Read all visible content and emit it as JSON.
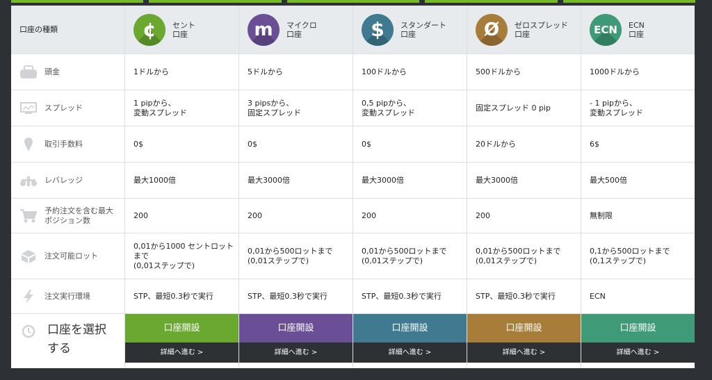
{
  "colors": {
    "cent": "#6aa830",
    "micro": "#6b4f96",
    "standard": "#3f7a91",
    "zero": "#a87d3a",
    "ecn": "#3e9a77",
    "background": "#2d3136"
  },
  "header": {
    "label": "口座の種類",
    "accounts": [
      {
        "glyph": "¢",
        "name_line1": "セント",
        "name_line2": "口座",
        "icon": "cent-icon"
      },
      {
        "glyph": "m",
        "name_line1": "マイクロ",
        "name_line2": "口座",
        "icon": "micro-icon"
      },
      {
        "glyph": "$",
        "name_line1": "スタンダート",
        "name_line2": "口座",
        "icon": "dollar-icon"
      },
      {
        "glyph": "Ø",
        "name_line1": "ゼロスプレッド",
        "name_line2": "口座",
        "icon": "zero-icon"
      },
      {
        "glyph": "ECN",
        "name_line1": "ECN",
        "name_line2": "口座",
        "icon": "ecn-icon"
      }
    ]
  },
  "rows": [
    {
      "label": "頭金",
      "icon": "wallet-icon",
      "values": [
        [
          "1ドルから"
        ],
        [
          "5ドルから"
        ],
        [
          "100ドルから"
        ],
        [
          "500ドルから"
        ],
        [
          "1000ドルから"
        ]
      ]
    },
    {
      "label": "スプレッド",
      "icon": "monitor-icon",
      "values": [
        [
          "1 pipから、",
          "変動スプレッド"
        ],
        [
          "3 pipsから、",
          "固定スプレッド"
        ],
        [
          "0,5 pipから、",
          "変動スプレッド"
        ],
        [
          "固定スプレッド 0 pip"
        ],
        [
          "- 1 pipから、",
          "変動スプレッド"
        ]
      ]
    },
    {
      "label": "取引手数料",
      "icon": "ice-cream-icon",
      "values": [
        [
          "0$"
        ],
        [
          "0$"
        ],
        [
          "0$"
        ],
        [
          "20ドルから"
        ],
        [
          "6$"
        ]
      ]
    },
    {
      "label": "レバレッジ",
      "icon": "scale-icon",
      "values": [
        [
          "最大1000倍"
        ],
        [
          "最大3000倍"
        ],
        [
          "最大3000倍"
        ],
        [
          "最大3000倍"
        ],
        [
          "最大500倍"
        ]
      ]
    },
    {
      "label_line1": "予約注文を含む最大",
      "label_line2": "ポジション数",
      "icon": "cart-icon",
      "values": [
        [
          "200"
        ],
        [
          "200"
        ],
        [
          "200"
        ],
        [
          "200"
        ],
        [
          "無制限"
        ]
      ]
    },
    {
      "label": "注文可能ロット",
      "icon": "box-icon",
      "values": [
        [
          "0,01から1000 セントロット",
          "まで",
          "(0,01ステップで)"
        ],
        [
          "0,01から500ロットまで",
          "(0,01ステップで)"
        ],
        [
          "0,01から500ロットまで",
          "(0,01ステップで)"
        ],
        [
          "0,01から500ロットまで",
          "(0,01ステップで)"
        ],
        [
          "0,1から500ロットまで",
          "(0,1ステップで)"
        ]
      ]
    },
    {
      "label": "注文実行環境",
      "icon": "lightning-icon",
      "values": [
        [
          "STP、最短0.3秒で実行"
        ],
        [
          "STP、最短0.3秒で実行"
        ],
        [
          "STP、最短0.3秒で実行"
        ],
        [
          "STP、最短0.3秒で実行"
        ],
        [
          "ECN"
        ]
      ]
    }
  ],
  "footer": {
    "select_line1": "口座を選択",
    "select_line2": "する",
    "open_label": "口座開設",
    "detail_label": "詳細へ進む >"
  }
}
